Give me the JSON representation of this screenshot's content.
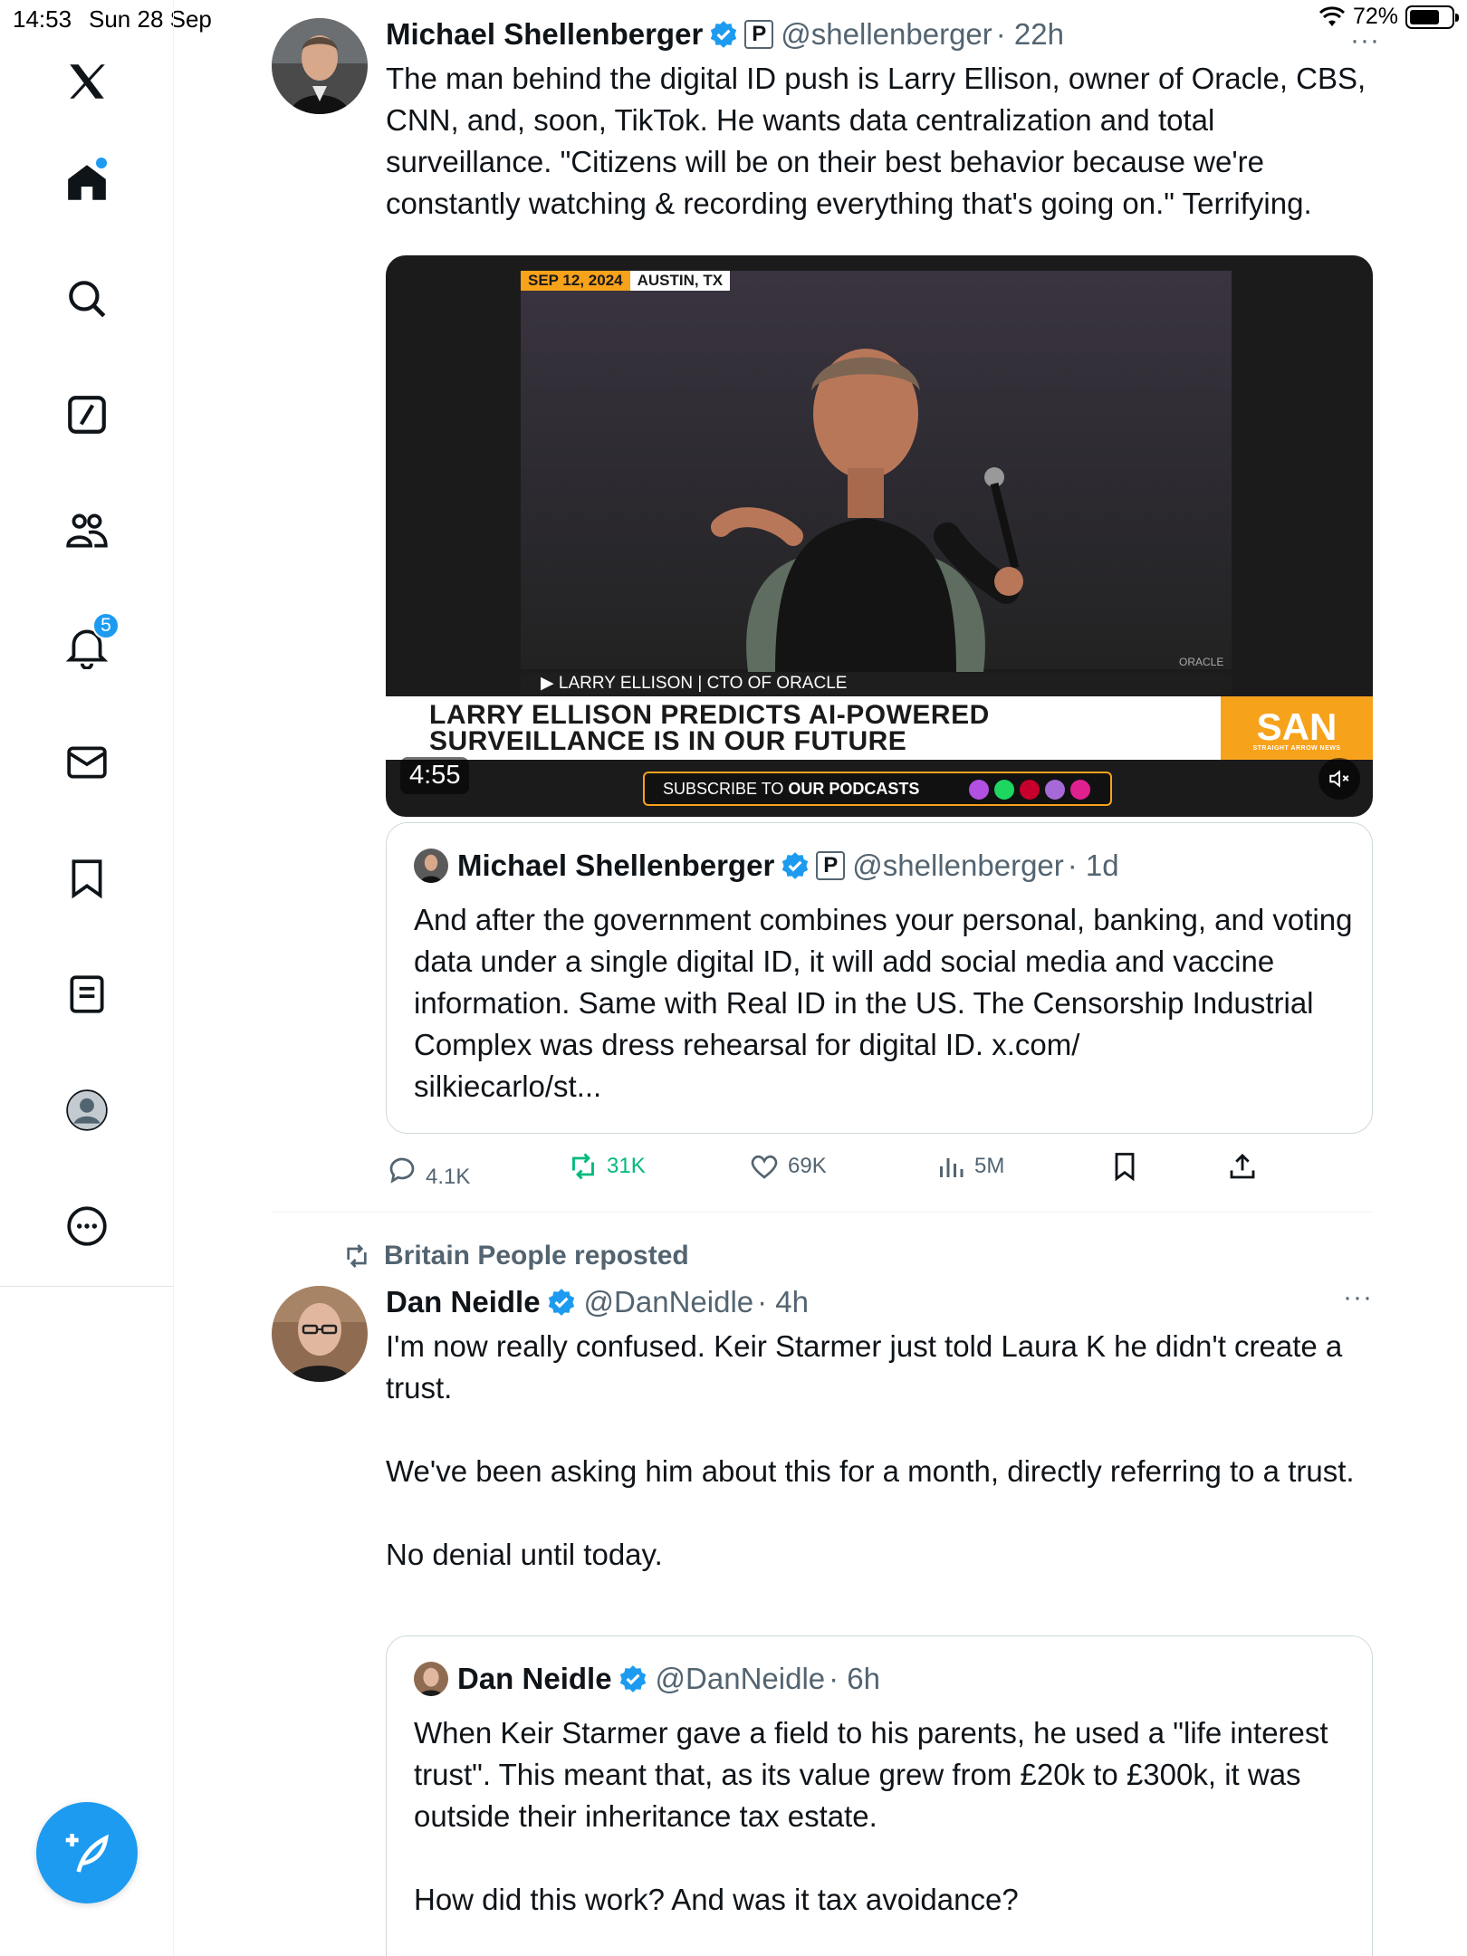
{
  "status": {
    "time": "14:53",
    "date": "Sun 28 Sep",
    "battery": "72%",
    "battery_level": 0.72
  },
  "nav": {
    "items": [
      "home",
      "search",
      "grok",
      "communities",
      "notifications",
      "messages",
      "bookmarks",
      "lists",
      "profile",
      "more"
    ],
    "notification_count": "5"
  },
  "tweets": [
    {
      "name": "Michael Shellenberger",
      "handle": "@shellenberger",
      "time": "· 22h",
      "text": "The man behind the digital ID push is Larry Ellison, owner of Oracle, CBS, CNN, and, soon, TikTok. He wants data centralization and total surveillance. \"Citizens will be on their best behavior because we're constantly watching & recording everything that's going on.\" Terrifying.",
      "video": {
        "date_tag": "SEP 12, 2024",
        "location_tag": "AUSTIN, TX",
        "speaker": "▶ LARRY ELLISON  |  CTO OF ORACLE",
        "headline_line1": "LARRY ELLISON PREDICTS AI-POWERED",
        "headline_line2": "SURVEILLANCE IS IN OUR FUTURE",
        "brand": "SAN",
        "brand_sub": "STRAIGHT ARROW NEWS",
        "watermark": "ORACLE",
        "duration": "4:55",
        "podcast_prefix": "SUBSCRIBE TO ",
        "podcast_bold": "OUR PODCASTS"
      },
      "quote": {
        "name": "Michael Shellenberger",
        "handle": "@shellenberger",
        "time": "· 1d",
        "text": "And after the government combines your personal, banking, and voting data under a single digital ID, it will add social media and vaccine information. Same with Real ID in the US. The Censorship Industrial Complex was dress rehearsal for digital ID. x.com/\nsilkiecarlo/st..."
      },
      "stats": {
        "replies": "4.1K",
        "reposts": "31K",
        "likes": "69K",
        "views": "5M"
      }
    },
    {
      "repost_by": "Britain People reposted",
      "name": "Dan Neidle",
      "handle": "@DanNeidle",
      "time": "· 4h",
      "text": "I'm now really confused. Keir Starmer just told Laura K he didn't create a trust.\n\nWe've been asking him about this for a month, directly referring to a trust.\n\nNo denial until today.",
      "quote": {
        "name": "Dan Neidle",
        "handle": "@DanNeidle",
        "time": "· 6h",
        "text": "When Keir Starmer gave a field to his parents, he used a \"life interest trust\". This meant that, as its value grew from £20k to £300k, it was outside their inheritance tax estate.\n\nHow did this work? And was it tax avoidance?"
      }
    }
  ],
  "colors": {
    "accent": "#1d9bf0",
    "repost_green": "#00ba7c",
    "text_secondary": "#536471",
    "san_orange": "#f7a21b"
  }
}
